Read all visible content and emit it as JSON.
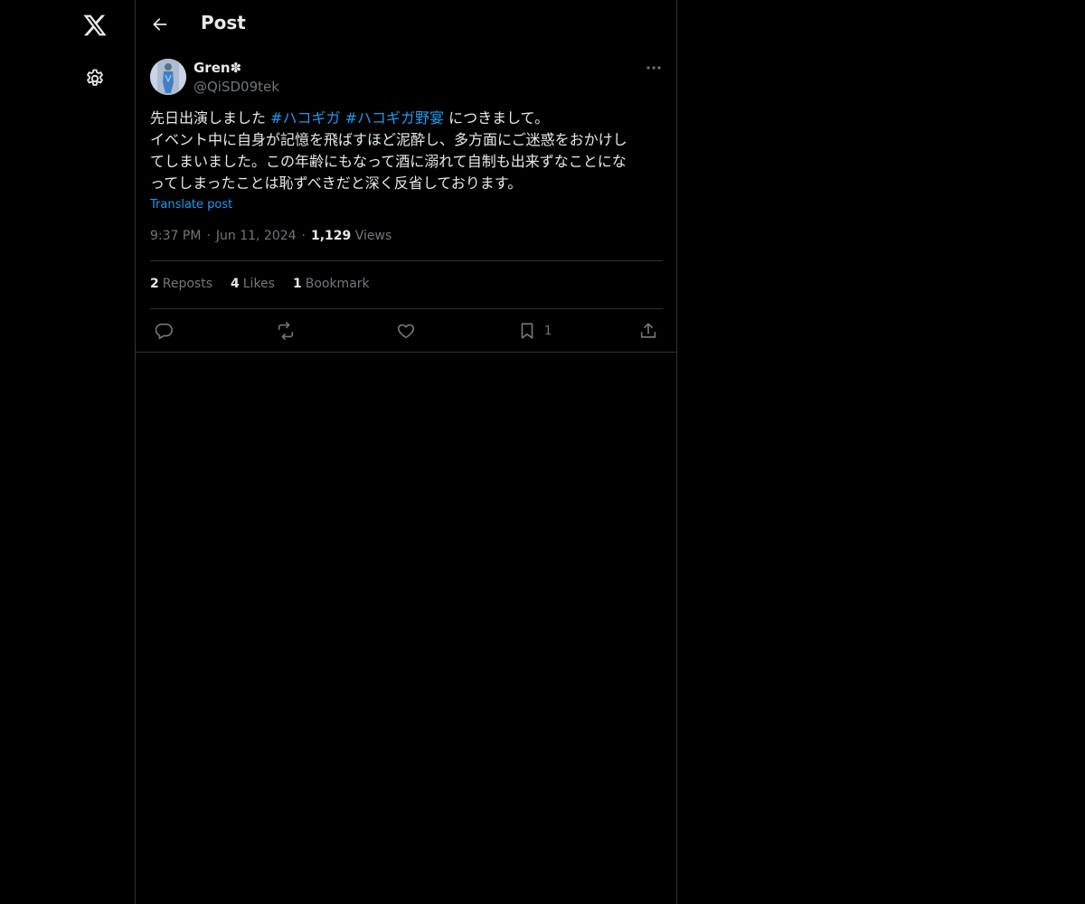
{
  "header": {
    "title": "Post"
  },
  "author": {
    "name": "Gren✽",
    "handle": "@QiSD09tek"
  },
  "post": {
    "text_before": "先日出演しました ",
    "hashtags": [
      "#ハコギガ",
      "#ハコギガ野宴"
    ],
    "text_mid": " につきまして。",
    "text_lines": [
      "イベント中に自身が記憶を飛ばすほど泥酔し、多方面にご迷惑をおかけし",
      "てしまいました。この年齢にもなって酒に溺れて自制も出来ずなことにな",
      "ってしまったことは恥ずべきだと深く反省しております。"
    ],
    "translate_label": "Translate post"
  },
  "meta": {
    "time": "9:37 PM",
    "date": "Jun 11, 2024",
    "views_count": "1,129",
    "views_label": "Views"
  },
  "stats": {
    "reposts_count": "2",
    "reposts_label": "Reposts",
    "likes_count": "4",
    "likes_label": "Likes",
    "bookmarks_count": "1",
    "bookmarks_label": "Bookmark"
  },
  "actions": {
    "bookmark_count": "1"
  },
  "icons": {
    "logo": "x-logo-icon",
    "settings": "gear-icon",
    "back": "arrow-left-icon",
    "more": "more-dots-icon",
    "reply": "reply-icon",
    "repost": "repost-icon",
    "like": "heart-icon",
    "bookmark": "bookmark-icon",
    "share": "share-icon"
  },
  "colors": {
    "background": "#000000",
    "text": "#e7e9ea",
    "muted": "#71767b",
    "link": "#1d9bf0",
    "border": "#2f3336"
  }
}
